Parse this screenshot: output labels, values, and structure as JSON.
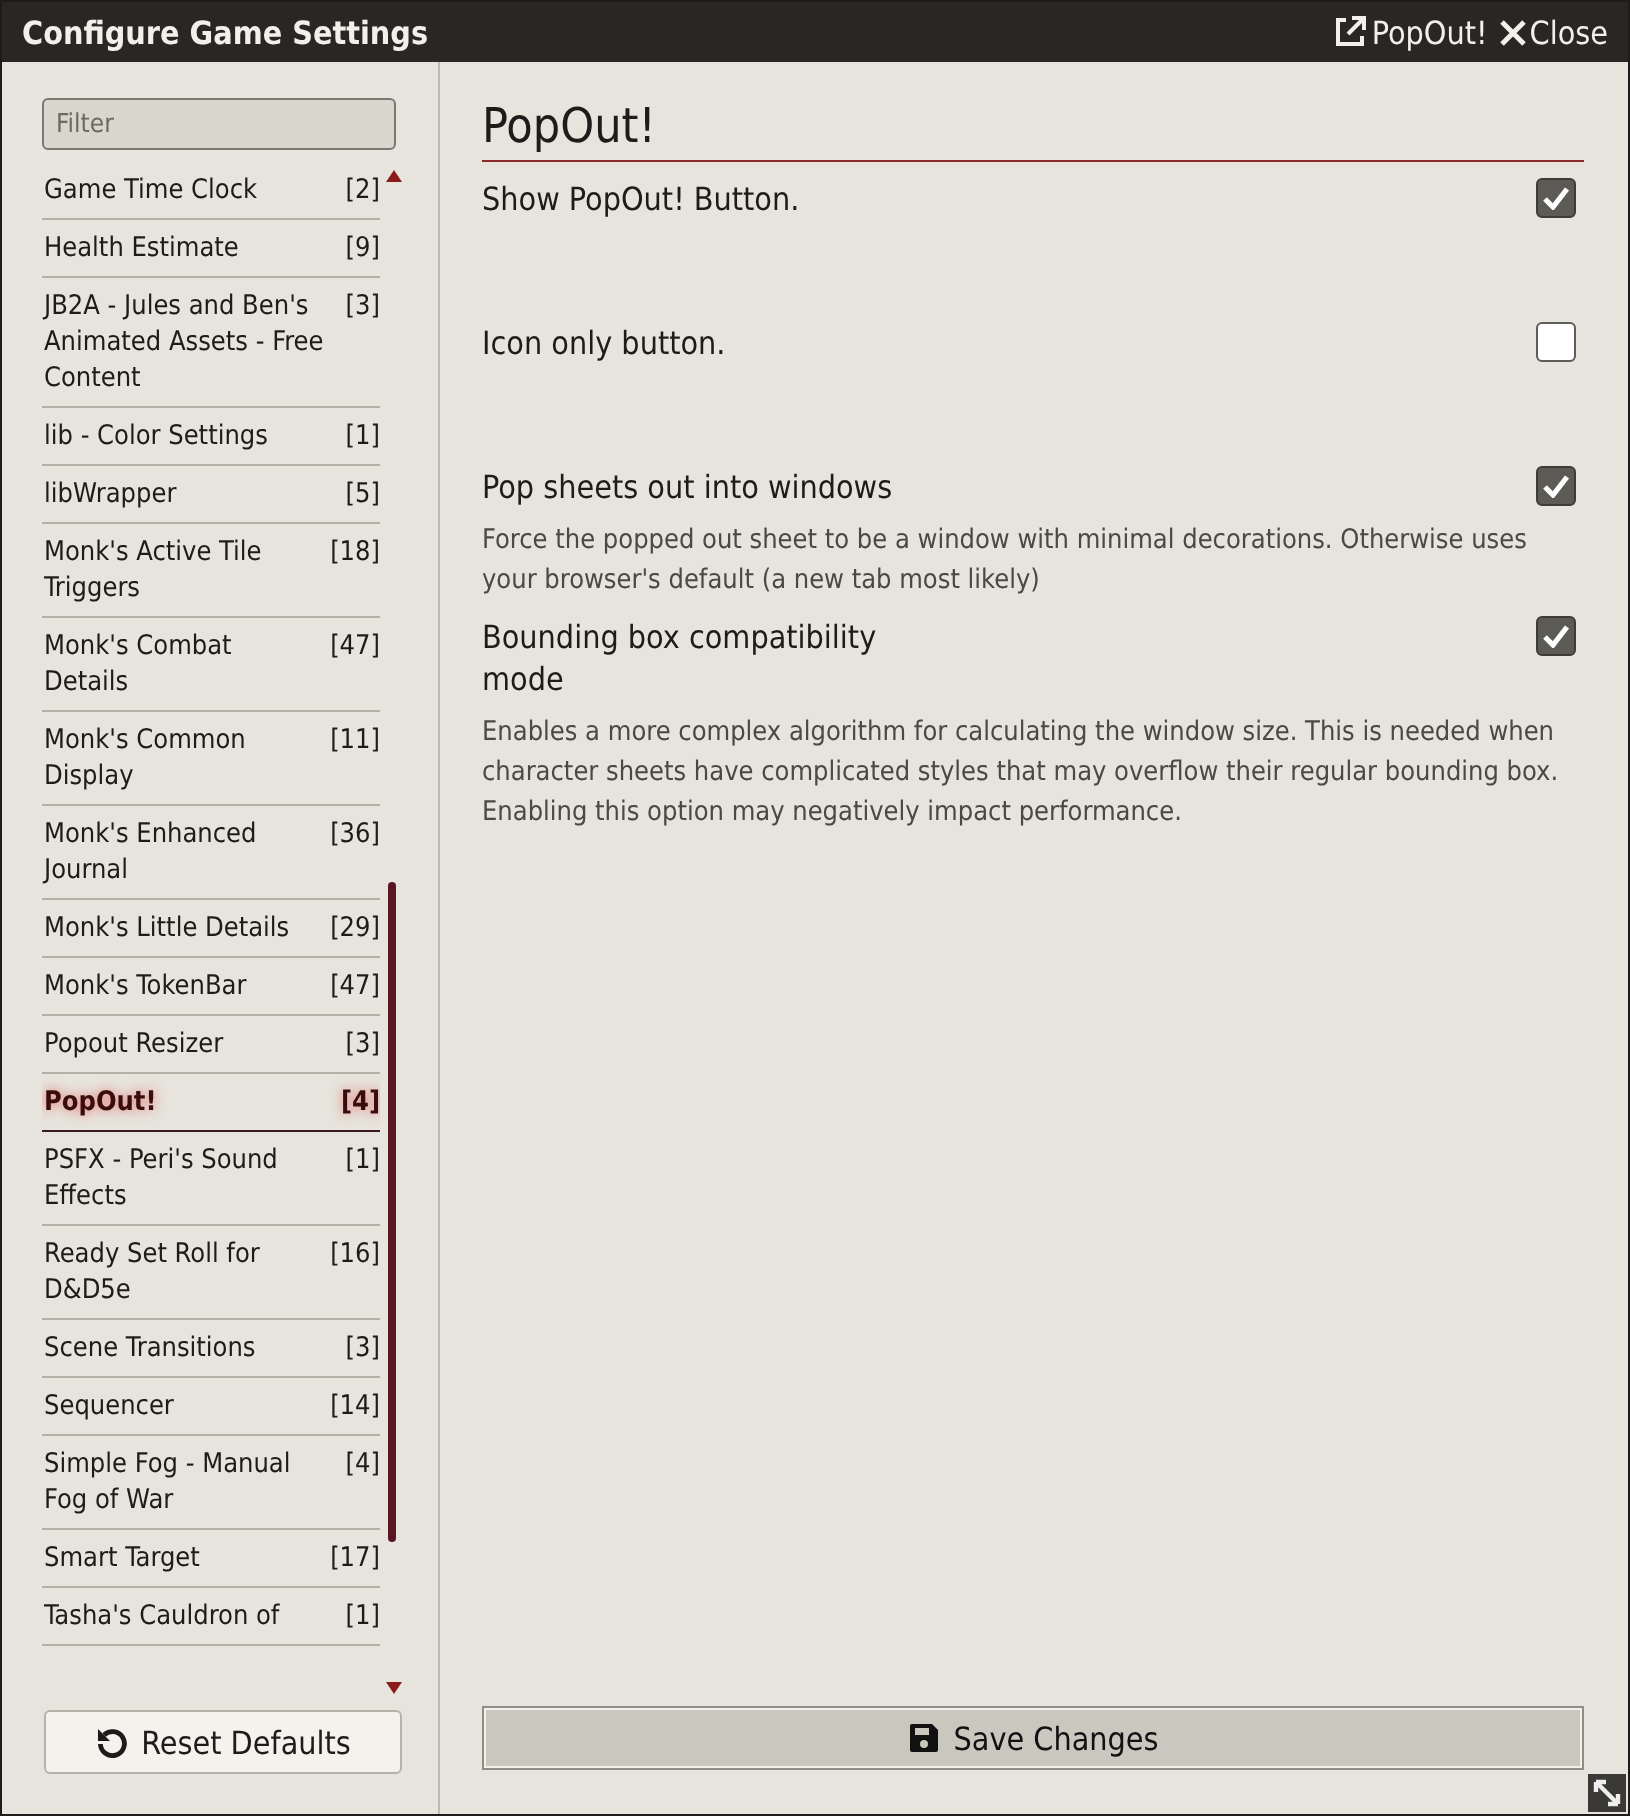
{
  "window": {
    "title": "Configure Game Settings",
    "header_buttons": [
      {
        "kind": "popout",
        "label": "PopOut!"
      },
      {
        "kind": "close",
        "label": "Close"
      }
    ]
  },
  "sidebar": {
    "filter": {
      "placeholder": "Filter"
    },
    "items": [
      {
        "name": "Game Time Clock",
        "count": "[2]",
        "selected": false
      },
      {
        "name": "Health Estimate",
        "count": "[9]",
        "selected": false
      },
      {
        "name": "JB2A - Jules and Ben's Animated Assets - Free Content",
        "count": "[3]",
        "selected": false
      },
      {
        "name": "lib - Color Settings",
        "count": "[1]",
        "selected": false
      },
      {
        "name": "libWrapper",
        "count": "[5]",
        "selected": false
      },
      {
        "name": "Monk's Active Tile Triggers",
        "count": "[18]",
        "selected": false
      },
      {
        "name": "Monk's Combat Details",
        "count": "[47]",
        "selected": false
      },
      {
        "name": "Monk's Common Display",
        "count": "[11]",
        "selected": false
      },
      {
        "name": "Monk's Enhanced Journal",
        "count": "[36]",
        "selected": false
      },
      {
        "name": "Monk's Little Details",
        "count": "[29]",
        "selected": false
      },
      {
        "name": "Monk's TokenBar",
        "count": "[47]",
        "selected": false
      },
      {
        "name": "Popout Resizer",
        "count": "[3]",
        "selected": false
      },
      {
        "name": "PopOut!",
        "count": "[4]",
        "selected": true
      },
      {
        "name": "PSFX - Peri's Sound Effects",
        "count": "[1]",
        "selected": false
      },
      {
        "name": "Ready Set Roll for D&D5e",
        "count": "[16]",
        "selected": false
      },
      {
        "name": "Scene Transitions",
        "count": "[3]",
        "selected": false
      },
      {
        "name": "Sequencer",
        "count": "[14]",
        "selected": false
      },
      {
        "name": "Simple Fog - Manual Fog of War",
        "count": "[4]",
        "selected": false
      },
      {
        "name": "Smart Target",
        "count": "[17]",
        "selected": false
      },
      {
        "name": "Tasha's Cauldron of",
        "count": "[1]",
        "selected": false
      }
    ],
    "reset_button": "Reset Defaults"
  },
  "content": {
    "title": "PopOut!",
    "settings": [
      {
        "kind": "checkbox",
        "label": "Show PopOut! Button.",
        "checked": true
      },
      {
        "kind": "checkbox",
        "label": "Icon only button.",
        "checked": false
      },
      {
        "kind": "checkbox",
        "label": "Pop sheets out into windows",
        "checked": true,
        "hint": "Force the popped out sheet to be a window with minimal decorations. Otherwise uses your browser's default (a new tab most likely)"
      },
      {
        "kind": "checkbox",
        "label": "Bounding box compatibility mode",
        "checked": true,
        "hint": "Enables a more complex algorithm for calculating the window size. This is needed when character sheets have complicated styles that may overflow their regular bounding box. Enabling this option may negatively impact performance."
      }
    ],
    "save_button": "Save Changes"
  }
}
